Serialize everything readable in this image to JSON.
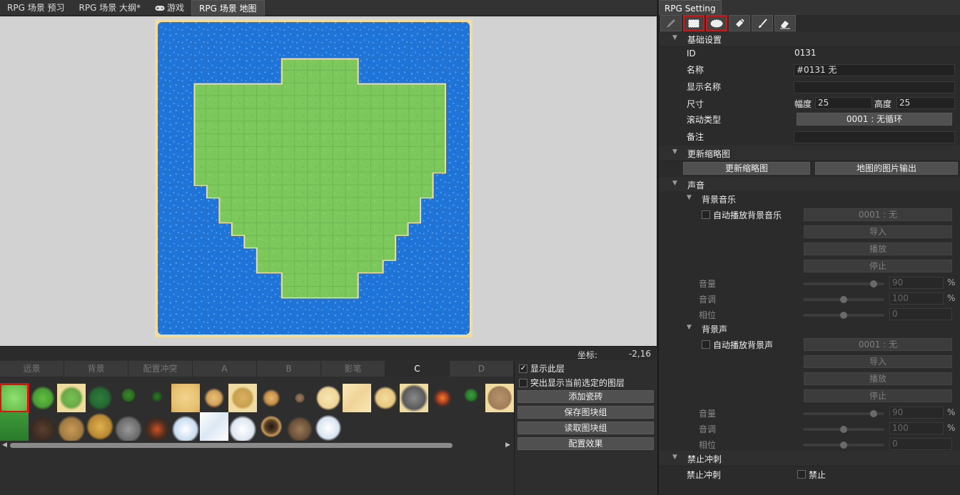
{
  "tabs": [
    {
      "label": "RPG 场景 预习"
    },
    {
      "label": "RPG 场景 大纲*"
    },
    {
      "label": "游戏"
    },
    {
      "label": "RPG 场景 地图"
    }
  ],
  "status": {
    "coord_label": "坐标:",
    "coord_value": "-2,16"
  },
  "tile_tabs": [
    "远景",
    "背景",
    "配置冲突",
    "A",
    "B",
    "影笔",
    "C",
    "D"
  ],
  "tile_tabs_active": "C",
  "layer_panel": {
    "show_layer": "显示此层",
    "highlight_layer": "突出显示当前选定的图层",
    "add_tile": "添加瓷砖",
    "save_group": "保存图块组",
    "load_group": "读取图块组",
    "config_effect": "配置效果"
  },
  "palette": {
    "row1": [
      "grass-tile",
      "grass-bush-tile",
      "grass-yellow-tile",
      "dark-grass-tile",
      "tree-tile",
      "small-tree-tile",
      "sand-hex-tile",
      "dust-tile",
      "sand-patch-tile",
      "sand-dust-tile",
      "dead-tree-tile",
      "sand-blob-tile",
      "sand-light-tile",
      "sand-splash-tile",
      "rocks-tile",
      "fire-rock-tile",
      "palm-tile",
      "brick-floor-tile"
    ],
    "row2": [
      "pine-forest-tile",
      "dark-mountain-tile",
      "rocky-hill-tile",
      "gold-rock-tile",
      "grey-mountain-tile",
      "volcano-tile",
      "snow-mountain-tile",
      "snow-field-tile",
      "snow-hill-tile",
      "crater-tile",
      "brown-rocks-tile",
      "snow-mound-tile"
    ]
  },
  "right": {
    "title": "RPG Setting",
    "tools": [
      "pencil-icon",
      "rect-select-icon",
      "ellipse-select-icon",
      "fill-bucket-icon",
      "brush-icon",
      "eraser-icon"
    ],
    "basic": {
      "header": "基础设置",
      "id_label": "ID",
      "id_value": "0131",
      "name_label": "名称",
      "name_value": "#0131 无",
      "display_name_label": "显示名称",
      "display_name_value": "",
      "size_label": "尺寸",
      "width_label": "幅度",
      "width_value": "25",
      "height_label": "高度",
      "height_value": "25",
      "scroll_label": "滚动类型",
      "scroll_value": "0001 : 无循环",
      "note_label": "备注",
      "note_value": ""
    },
    "thumb": {
      "header": "更新缩略图",
      "update_btn": "更新缩略图",
      "export_btn": "地图的图片输出"
    },
    "sound": {
      "header": "声音",
      "bgm": {
        "header": "背景音乐",
        "auto_label": "自动播放背景音乐",
        "auto_value": "0001 : 无",
        "import": "导入",
        "play": "播放",
        "stop": "停止",
        "volume_label": "音量",
        "volume": "90",
        "volume_level": 0.9,
        "pitch_label": "音调",
        "pitch": "100",
        "pitch_level": 0.5,
        "phase_label": "相位",
        "phase": "0",
        "phase_level": 0.5,
        "pct": "%"
      },
      "bgs": {
        "header": "背景声",
        "auto_label": "自动播放背景声",
        "auto_value": "0001 : 无",
        "import": "导入",
        "play": "播放",
        "stop": "停止",
        "volume_label": "音量",
        "volume": "90",
        "volume_level": 0.9,
        "pitch_label": "音调",
        "pitch": "100",
        "pitch_level": 0.5,
        "phase_label": "相位",
        "phase": "0",
        "phase_level": 0.5,
        "pct": "%"
      }
    },
    "dash": {
      "header": "禁止冲刺",
      "label": "禁止冲刺",
      "check_label": "禁止"
    }
  },
  "map": {
    "cols": 25,
    "rows": 25,
    "water_color": "#1e74d8",
    "grass_color": "#7cc85c",
    "sand_color": "#f0dca0",
    "land_rows": [
      [
        10,
        15
      ],
      [
        10,
        15
      ],
      [
        3,
        22
      ],
      [
        3,
        22
      ],
      [
        3,
        22
      ],
      [
        3,
        22
      ],
      [
        3,
        22
      ],
      [
        3,
        22
      ],
      [
        3,
        22
      ],
      [
        3,
        21
      ],
      [
        4,
        21
      ],
      [
        5,
        20
      ],
      [
        5,
        20
      ],
      [
        6,
        19
      ],
      [
        7,
        18
      ],
      [
        8,
        18
      ],
      [
        8,
        17
      ],
      [
        10,
        15
      ],
      [
        10,
        15
      ]
    ],
    "land_start_row": 3
  },
  "colors": {
    "highlight": "#e01010",
    "accent": "#d2d2d2"
  }
}
